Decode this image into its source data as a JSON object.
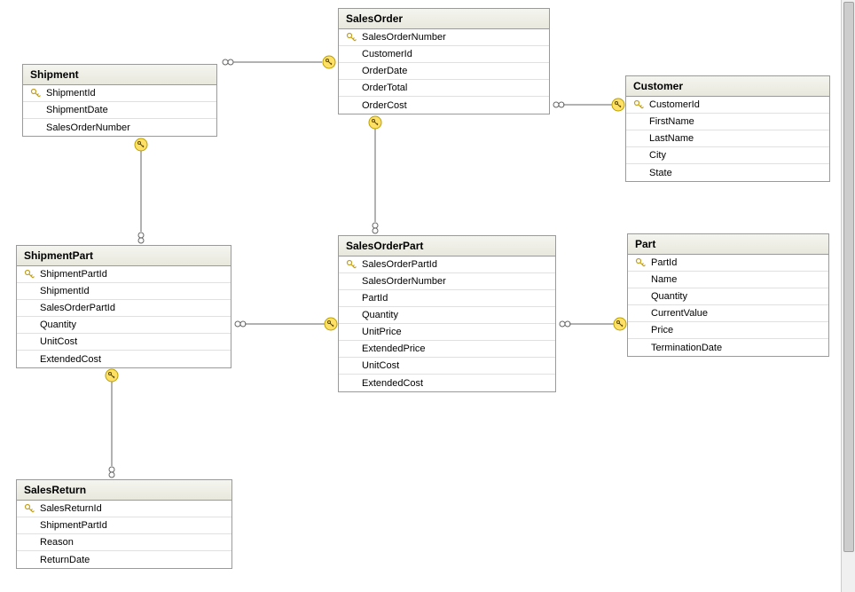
{
  "entities": {
    "salesOrder": {
      "title": "SalesOrder",
      "columns": [
        {
          "name": "SalesOrderNumber",
          "pk": true
        },
        {
          "name": "CustomerId",
          "pk": false
        },
        {
          "name": "OrderDate",
          "pk": false
        },
        {
          "name": "OrderTotal",
          "pk": false
        },
        {
          "name": "OrderCost",
          "pk": false
        }
      ]
    },
    "shipment": {
      "title": "Shipment",
      "columns": [
        {
          "name": "ShipmentId",
          "pk": true
        },
        {
          "name": "ShipmentDate",
          "pk": false
        },
        {
          "name": "SalesOrderNumber",
          "pk": false
        }
      ]
    },
    "customer": {
      "title": "Customer",
      "columns": [
        {
          "name": "CustomerId",
          "pk": true
        },
        {
          "name": "FirstName",
          "pk": false
        },
        {
          "name": "LastName",
          "pk": false
        },
        {
          "name": "City",
          "pk": false
        },
        {
          "name": "State",
          "pk": false
        }
      ]
    },
    "shipmentPart": {
      "title": "ShipmentPart",
      "columns": [
        {
          "name": "ShipmentPartId",
          "pk": true
        },
        {
          "name": "ShipmentId",
          "pk": false
        },
        {
          "name": "SalesOrderPartId",
          "pk": false
        },
        {
          "name": "Quantity",
          "pk": false
        },
        {
          "name": "UnitCost",
          "pk": false
        },
        {
          "name": "ExtendedCost",
          "pk": false
        }
      ]
    },
    "salesOrderPart": {
      "title": "SalesOrderPart",
      "columns": [
        {
          "name": "SalesOrderPartId",
          "pk": true
        },
        {
          "name": "SalesOrderNumber",
          "pk": false
        },
        {
          "name": "PartId",
          "pk": false
        },
        {
          "name": "Quantity",
          "pk": false
        },
        {
          "name": "UnitPrice",
          "pk": false
        },
        {
          "name": "ExtendedPrice",
          "pk": false
        },
        {
          "name": "UnitCost",
          "pk": false
        },
        {
          "name": "ExtendedCost",
          "pk": false
        }
      ]
    },
    "part": {
      "title": "Part",
      "columns": [
        {
          "name": "PartId",
          "pk": true
        },
        {
          "name": "Name",
          "pk": false
        },
        {
          "name": "Quantity",
          "pk": false
        },
        {
          "name": "CurrentValue",
          "pk": false
        },
        {
          "name": "Price",
          "pk": false
        },
        {
          "name": "TerminationDate",
          "pk": false
        }
      ]
    },
    "salesReturn": {
      "title": "SalesReturn",
      "columns": [
        {
          "name": "SalesReturnId",
          "pk": true
        },
        {
          "name": "ShipmentPartId",
          "pk": false
        },
        {
          "name": "Reason",
          "pk": false
        },
        {
          "name": "ReturnDate",
          "pk": false
        }
      ]
    }
  }
}
